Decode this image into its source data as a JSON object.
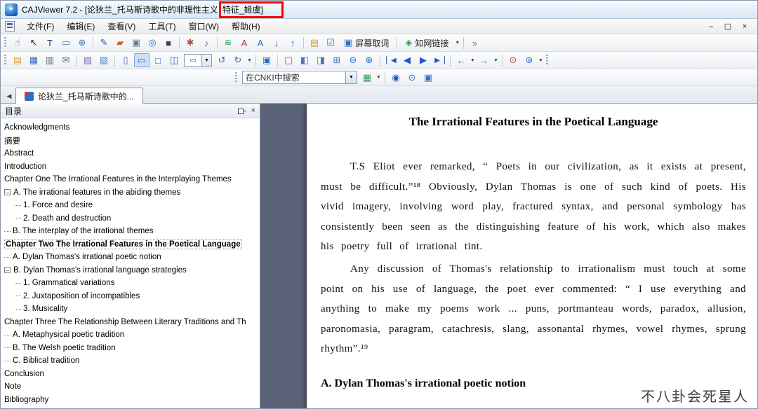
{
  "titlebar": {
    "title_prefix": "CAJViewer 7.2 - [论狄兰_托马斯诗歌中的非理性主义",
    "title_highlight": "特征_姬虞]"
  },
  "menubar": {
    "items": [
      "文件(F)",
      "编辑(E)",
      "查看(V)",
      "工具(T)",
      "窗口(W)",
      "帮助(H)"
    ],
    "controls": [
      {
        "name": "minimize-button",
        "glyph": "–"
      },
      {
        "name": "restore-button",
        "glyph": "▢"
      },
      {
        "name": "close-button",
        "glyph": "×"
      }
    ]
  },
  "toolbar_main": {
    "icons": [
      {
        "type": "grip"
      },
      {
        "type": "icon",
        "name": "hand-tool-icon",
        "glyph": "☝",
        "color": "#2c6fc4"
      },
      {
        "type": "icon",
        "name": "select-tool-icon",
        "glyph": "↖",
        "color": "#222222"
      },
      {
        "type": "icon",
        "name": "text-select-tool-icon",
        "glyph": "T",
        "color": "#1a3f8f"
      },
      {
        "type": "icon",
        "name": "image-select-tool-icon",
        "glyph": "▭",
        "color": "#4a7ab5"
      },
      {
        "type": "icon",
        "name": "zoom-tool-icon",
        "glyph": "⊕",
        "color": "#4a7ab5"
      },
      {
        "type": "sep"
      },
      {
        "type": "icon",
        "name": "pen-tool-icon",
        "glyph": "✎",
        "color": "#1f56c8"
      },
      {
        "type": "icon",
        "name": "highlighter-tool-icon",
        "glyph": "▰",
        "color": "#d2691e"
      },
      {
        "type": "icon",
        "name": "camera-tool-icon",
        "glyph": "▣",
        "color": "#6b7c93"
      },
      {
        "type": "icon",
        "name": "target-tool-icon",
        "glyph": "◎",
        "color": "#3a74c9"
      },
      {
        "type": "icon",
        "name": "crop-tool-icon",
        "glyph": "■",
        "color": "#39424e"
      },
      {
        "type": "sep"
      },
      {
        "type": "icon",
        "name": "stamp-tool-icon",
        "glyph": "✱",
        "color": "#b3453c"
      },
      {
        "type": "icon",
        "name": "sound-note-tool-icon",
        "glyph": "♪",
        "color": "#7a4fb5"
      },
      {
        "type": "sep"
      },
      {
        "type": "icon",
        "name": "highlight-text-icon",
        "glyph": "≋",
        "color": "#2e9e4f"
      },
      {
        "type": "icon",
        "name": "underline-text-icon",
        "glyph": "A",
        "color": "#c0392b"
      },
      {
        "type": "icon",
        "name": "strikeout-text-icon",
        "glyph": "A",
        "color": "#2c6fc4"
      },
      {
        "type": "icon",
        "name": "arrow-down-annotation-icon",
        "glyph": "↓",
        "color": "#2c6fc4"
      },
      {
        "type": "icon",
        "name": "arrow-up-annotation-icon",
        "glyph": "↑",
        "color": "#2c6fc4"
      },
      {
        "type": "sep"
      },
      {
        "type": "icon",
        "name": "note-page-icon",
        "glyph": "▤",
        "color": "#c8a227"
      },
      {
        "type": "icon",
        "name": "word-capture-check-icon",
        "glyph": "☑",
        "color": "#2c6fc4"
      },
      {
        "type": "button",
        "name": "screen-capture-button",
        "icon_name": "screen-capture-icon",
        "icon_glyph": "▣",
        "icon_color": "#2c6fc4",
        "label": "屏幕取词"
      },
      {
        "type": "sep"
      },
      {
        "type": "button",
        "name": "cnki-link-button",
        "icon_name": "cnki-link-icon",
        "icon_glyph": "◈",
        "icon_color": "#2e9e4f",
        "label": "知网链接",
        "dropdown": true
      },
      {
        "type": "sep"
      },
      {
        "type": "icon",
        "name": "more-tools-icon",
        "glyph": "»",
        "color": "#667788"
      }
    ]
  },
  "toolbar_file": {
    "icons": [
      {
        "type": "grip"
      },
      {
        "type": "icon",
        "name": "open-file-icon",
        "glyph": "▤",
        "color": "#d9a62e"
      },
      {
        "type": "icon",
        "name": "save-icon",
        "glyph": "▦",
        "color": "#2c6fc4"
      },
      {
        "type": "icon",
        "name": "print-icon",
        "glyph": "▥",
        "color": "#5a6b7d"
      },
      {
        "type": "icon",
        "name": "email-icon",
        "glyph": "✉",
        "color": "#5a6b7d"
      },
      {
        "type": "sep"
      },
      {
        "type": "icon",
        "name": "copy-icon",
        "glyph": "▨",
        "color": "#7d6bb0"
      },
      {
        "type": "icon",
        "name": "snapshot-icon",
        "glyph": "▧",
        "color": "#4a7ab5"
      },
      {
        "type": "sep"
      },
      {
        "type": "icon",
        "name": "single-page-view-icon",
        "glyph": "▯",
        "color": "#2c6fc4"
      },
      {
        "type": "icon",
        "name": "fit-width-view-icon",
        "glyph": "▭",
        "color": "#2c6fc4",
        "selected": true
      },
      {
        "type": "icon",
        "name": "fit-page-view-icon",
        "glyph": "□",
        "color": "#2c6fc4"
      },
      {
        "type": "icon",
        "name": "two-page-view-icon",
        "glyph": "◫",
        "color": "#2c6fc4"
      },
      {
        "type": "combo",
        "name": "zoom-level-combo",
        "glyph": "▭"
      },
      {
        "type": "icon",
        "name": "rotate-left-icon",
        "glyph": "↺",
        "color": "#2c6fc4"
      },
      {
        "type": "icon",
        "name": "rotate-right-icon",
        "glyph": "↻",
        "color": "#2c6fc4",
        "dropdown": true
      },
      {
        "type": "sep"
      },
      {
        "type": "icon",
        "name": "full-screen-icon",
        "glyph": "▣",
        "color": "#2c6fc4"
      },
      {
        "type": "sep"
      },
      {
        "type": "icon",
        "name": "page-panel-icon",
        "glyph": "▢",
        "color": "#4a7ab5"
      },
      {
        "type": "icon",
        "name": "bookmark-panel-icon",
        "glyph": "◧",
        "color": "#4a7ab5"
      },
      {
        "type": "icon",
        "name": "annotation-panel-icon",
        "glyph": "◨",
        "color": "#4a7ab5"
      },
      {
        "type": "icon",
        "name": "search-panel-icon",
        "glyph": "⊞",
        "color": "#4a7ab5"
      },
      {
        "type": "icon",
        "name": "zoom-out-icon",
        "glyph": "⊖",
        "color": "#2c6fc4"
      },
      {
        "type": "icon",
        "name": "zoom-in-icon",
        "glyph": "⊕",
        "color": "#2c6fc4"
      },
      {
        "type": "sep"
      },
      {
        "type": "icon",
        "name": "first-page-icon",
        "glyph": "▏◀",
        "color": "#1f56c8",
        "small": true
      },
      {
        "type": "icon",
        "name": "previous-page-icon",
        "glyph": "◀",
        "color": "#1f56c8"
      },
      {
        "type": "icon",
        "name": "next-page-icon",
        "glyph": "▶",
        "color": "#1f56c8"
      },
      {
        "type": "icon",
        "name": "last-page-icon",
        "glyph": "▶▕",
        "color": "#1f56c8",
        "small": true
      },
      {
        "type": "sep"
      },
      {
        "type": "icon",
        "name": "back-view-icon",
        "glyph": "←",
        "color": "#2c6fc4",
        "dropdown": true
      },
      {
        "type": "icon",
        "name": "forward-view-icon",
        "glyph": "→",
        "color": "#2c6fc4",
        "dropdown": true
      },
      {
        "type": "sep"
      },
      {
        "type": "icon",
        "name": "find-icon",
        "glyph": "⊙",
        "color": "#b3453c"
      },
      {
        "type": "icon",
        "name": "find-next-icon",
        "glyph": "⊚",
        "color": "#2c6fc4",
        "dropdown": true
      },
      {
        "type": "grip"
      }
    ]
  },
  "toolbar_search": {
    "combo_value": "在CNKI中搜索",
    "icons_after": [
      {
        "type": "icon",
        "name": "search-go-icon",
        "glyph": "▦",
        "color": "#2e9e4f",
        "dropdown": true
      },
      {
        "type": "sep"
      },
      {
        "type": "icon",
        "name": "sync-browse-icon",
        "glyph": "◉",
        "color": "#1f56c8"
      },
      {
        "type": "icon",
        "name": "help-icon",
        "glyph": "⊙",
        "color": "#2c6fc4"
      },
      {
        "type": "icon",
        "name": "library-icon",
        "glyph": "▣",
        "color": "#2c6fc4"
      }
    ]
  },
  "tabbar": {
    "scroll_left_glyph": "◀",
    "tab_label": "论狄兰_托马斯诗歌中的..."
  },
  "toc_panel": {
    "title": "目录",
    "items": [
      {
        "label": "Acknowledgments",
        "level": 0
      },
      {
        "label": "摘要",
        "level": 0
      },
      {
        "label": "Abstract",
        "level": 0
      },
      {
        "label": "Introduction",
        "level": 0
      },
      {
        "label": "Chapter One The Irrational Features in the Interplaying Themes",
        "level": 0
      },
      {
        "label": "A. The irrational features in the abiding themes",
        "level": 1,
        "expander": true
      },
      {
        "label": "1. Force and desire",
        "level": 2
      },
      {
        "label": "2. Death and destruction",
        "level": 2
      },
      {
        "label": "B. The interplay of the irrational themes",
        "level": 1
      },
      {
        "label": "Chapter Two The Irrational Features in the Poetical Language",
        "level": 0,
        "selected": true
      },
      {
        "label": "A. Dylan Thomas's irrational poetic notion",
        "level": 1
      },
      {
        "label": "B. Dylan Thomas's irrational language strategies",
        "level": 1,
        "expander": true
      },
      {
        "label": "1. Grammatical variations",
        "level": 2
      },
      {
        "label": "2. Juxtaposition of incompatibles",
        "level": 2
      },
      {
        "label": "3. Musicality",
        "level": 2
      },
      {
        "label": "Chapter Three The Relationship Between Literary Traditions and Th",
        "level": 0
      },
      {
        "label": "A. Metaphysical poetic tradition",
        "level": 1
      },
      {
        "label": "B. The Welsh poetic tradition",
        "level": 1
      },
      {
        "label": "C. Biblical tradition",
        "level": 1
      },
      {
        "label": "Conclusion",
        "level": 0
      },
      {
        "label": "Note",
        "level": 0
      },
      {
        "label": "Bibliography",
        "level": 0
      }
    ]
  },
  "document": {
    "title": "The Irrational Features in the Poetical Language",
    "paragraphs": [
      "T.S Eliot ever remarked, “ Poets in our civilization, as it exists at present, must be difficult.”¹⁸ Obviously, Dylan Thomas is one of such kind of poets. His vivid imagery, involving word play, fractured syntax, and personal symbology has consistently been seen as the distinguishing feature of his work, which also makes his poetry full of irrational tint.",
      "Any discussion of Thomas's relationship to irrationalism must touch at some point on his use of language, the poet ever commented: “ I use everything and anything to make my poems work ... puns, portmanteau words, paradox, allusion, paronomasia, paragram, catachresis, slang, assonantal rhymes, vowel rhymes, sprung rhythm”.¹⁹"
    ],
    "section_heading": "A. Dylan Thomas's irrational poetic notion",
    "watermark": "不八卦会死星人"
  },
  "colors": {
    "accent_blue": "#2c6fc4",
    "document_background": "#5a6377",
    "annotation_red": "#ff0000"
  }
}
